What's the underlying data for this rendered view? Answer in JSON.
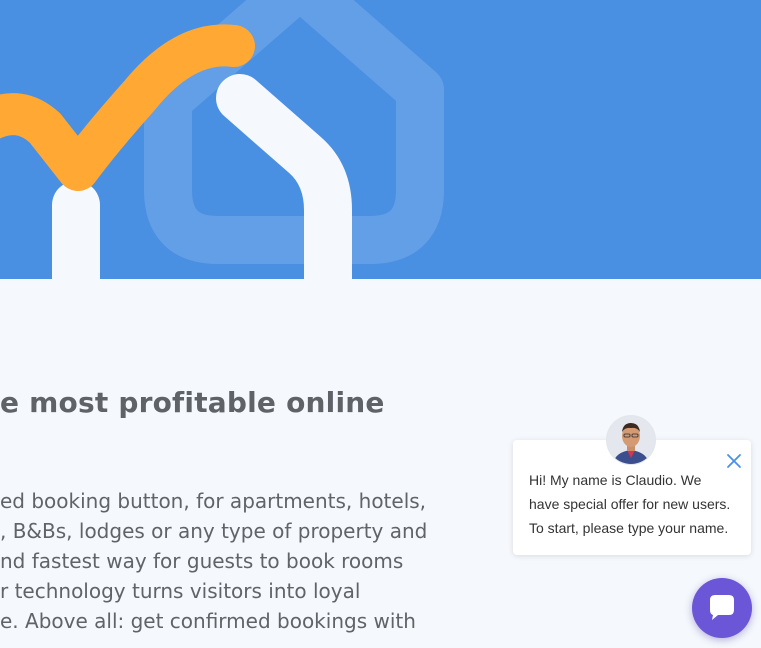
{
  "hero": {
    "accent_color": "#4a90e2",
    "check_color": "#ffa833",
    "house_icon": "house-check-logo"
  },
  "content": {
    "headline": "e most profitable online",
    "body_lines": [
      "ed booking button, for apartments, hotels,",
      ", B&Bs, lodges or any type of property and",
      "nd fastest way for guests to book rooms",
      "r technology turns visitors into loyal",
      "e. Above all: get confirmed bookings with"
    ]
  },
  "chat": {
    "agent_name": "Claudio",
    "message_lines": [
      "Hi! My name is Claudio. We",
      "have special offer for new users.",
      "To start, please type your name."
    ],
    "launcher_color": "#6c56d8"
  }
}
